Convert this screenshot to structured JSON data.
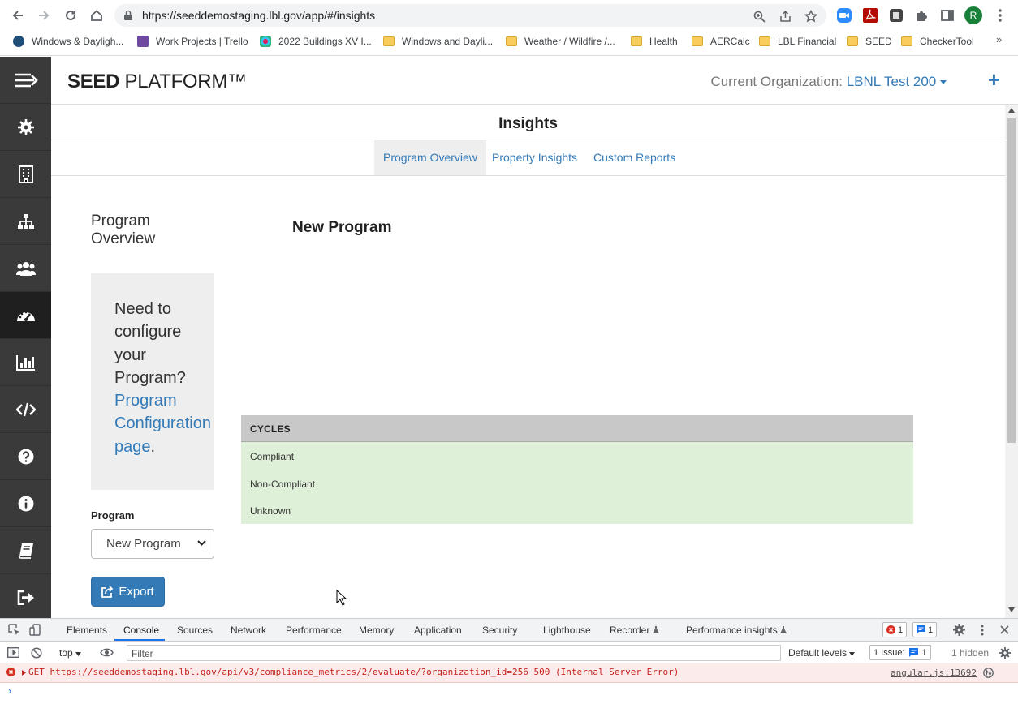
{
  "browser": {
    "url": "https://seeddemostaging.lbl.gov/app/#/insights",
    "profile_initial": "R",
    "bookmarks": [
      {
        "label": "Windows & Dayligh...",
        "icon": "eta-icon"
      },
      {
        "label": "Work Projects | Trello",
        "icon": "trello-icon"
      },
      {
        "label": "2022 Buildings XV I...",
        "icon": "slack-icon"
      },
      {
        "label": "Windows and Dayli...",
        "icon": "folder-icon"
      },
      {
        "label": "Weather / Wildfire /...",
        "icon": "folder-icon"
      },
      {
        "label": "Health",
        "icon": "folder-icon"
      },
      {
        "label": "AERCalc",
        "icon": "folder-icon"
      },
      {
        "label": "LBL Financial",
        "icon": "folder-icon"
      },
      {
        "label": "SEED",
        "icon": "folder-icon"
      },
      {
        "label": "CheckerTool",
        "icon": "folder-icon"
      }
    ],
    "more": "»"
  },
  "app": {
    "brand_bold": "SEED",
    "brand_rest": " PLATFORM™",
    "org_label": "Current Organization: ",
    "org_name": "LBNL Test 200",
    "plus": "+"
  },
  "sidebar": {
    "items": [
      {
        "name": "menu-toggle-icon"
      },
      {
        "name": "gear-icon"
      },
      {
        "name": "building-icon"
      },
      {
        "name": "sitemap-icon"
      },
      {
        "name": "users-icon"
      },
      {
        "name": "dashboard-icon",
        "active": true
      },
      {
        "name": "bar-chart-icon"
      },
      {
        "name": "code-icon"
      },
      {
        "name": "help-icon"
      },
      {
        "name": "info-icon"
      },
      {
        "name": "book-icon"
      },
      {
        "name": "sign-out-icon"
      }
    ]
  },
  "page": {
    "title": "Insights",
    "tabs": [
      {
        "label": "Program Overview",
        "active": true
      },
      {
        "label": "Property Insights"
      },
      {
        "label": "Custom Reports"
      }
    ],
    "left_title": "Program Overview",
    "config_text": "Need to configure your Program?",
    "config_link": "Program Configuration page",
    "config_end": ".",
    "program_label": "Program",
    "program_selected": "New Program",
    "export_label": "Export",
    "program_heading": "New Program",
    "cycles": {
      "header": "CYCLES",
      "rows": [
        "Compliant",
        "Non-Compliant",
        "Unknown"
      ],
      "row_color": "#dff0d8"
    }
  },
  "devtools": {
    "tabs": [
      "Elements",
      "Console",
      "Sources",
      "Network",
      "Performance",
      "Memory",
      "Application",
      "Security",
      "Lighthouse",
      "Recorder",
      "Performance insights"
    ],
    "active_tab": "Console",
    "error_count": "1",
    "message_count": "1",
    "context": "top",
    "filter_placeholder": "Filter",
    "levels": "Default levels",
    "issues_label": "1 Issue:",
    "issues_count": "1",
    "hidden": "1 hidden",
    "error_method": "GET",
    "error_url": "https://seeddemostaging.lbl.gov/api/v3/compliance_metrics/2/evaluate/?organization_id=256",
    "error_status": "500 (Internal Server Error)",
    "error_source": "angular.js:13692",
    "prompt": "›"
  },
  "colors": {
    "brand_blue": "#337ab7",
    "sidebar_bg": "#3a3a3a",
    "error_red": "#c5221f"
  }
}
